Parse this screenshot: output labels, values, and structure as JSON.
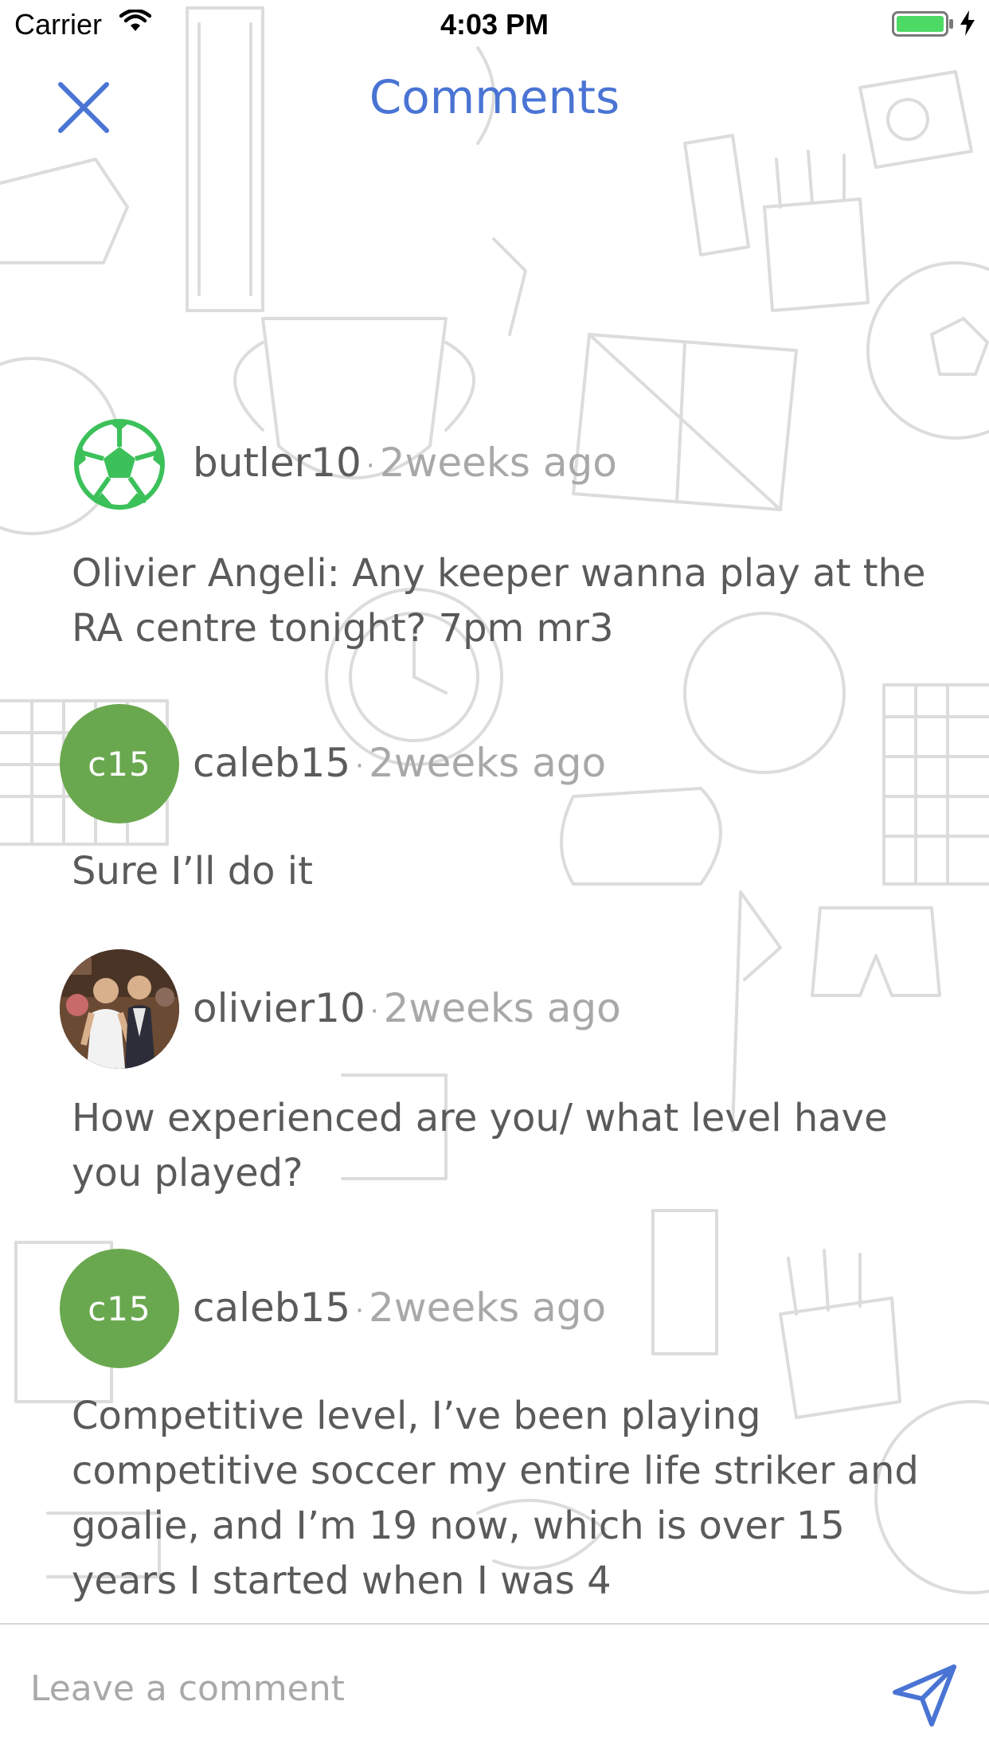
{
  "status_bar": {
    "carrier": "Carrier",
    "time": "4:03 PM"
  },
  "header": {
    "title": "Comments",
    "close_icon": "close-x-icon"
  },
  "comments": [
    {
      "username": "butler10",
      "time_ago": "2weeks ago",
      "avatar": {
        "type": "icon",
        "icon": "soccer-ball-icon",
        "color": "#3cc15a"
      },
      "text": "Olivier Angeli:  Any keeper wanna play at the RA centre tonight? 7pm mr3"
    },
    {
      "username": "caleb15",
      "time_ago": "2weeks ago",
      "avatar": {
        "type": "initials",
        "initials": "c15",
        "color": "#6aa84f"
      },
      "text": "Sure I’ll do it"
    },
    {
      "username": "olivier10",
      "time_ago": "2weeks ago",
      "avatar": {
        "type": "photo",
        "icon": "profile-photo"
      },
      "text": "How experienced are you/ what level have you played?"
    },
    {
      "username": "caleb15",
      "time_ago": "2weeks ago",
      "avatar": {
        "type": "initials",
        "initials": "c15",
        "color": "#6aa84f"
      },
      "text": "Competitive level, I’ve been playing competitive soccer my entire life striker and goalie, and I’m 19 now, which is over 15 years  I started when I was 4"
    }
  ],
  "composer": {
    "placeholder": "Leave a comment",
    "value": "",
    "send_icon": "send-paper-plane-icon"
  },
  "colors": {
    "accent": "#4a74d4",
    "avatar_green": "#6aa84f",
    "ball_green": "#3cc15a",
    "battery_green": "#4cd964"
  }
}
